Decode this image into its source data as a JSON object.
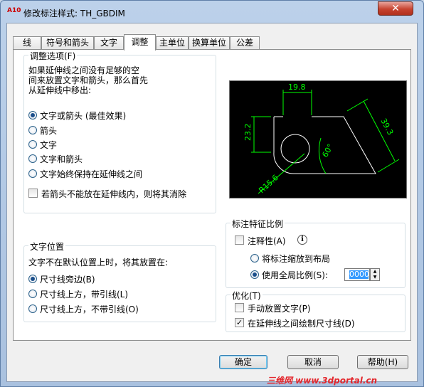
{
  "window": {
    "title": "修改标注样式: TH_GBDIM",
    "app_icon_text": "A10",
    "close_glyph": "✕"
  },
  "tabs": [
    {
      "label": "线",
      "active": false
    },
    {
      "label": "符号和箭头",
      "active": false
    },
    {
      "label": "文字",
      "active": false
    },
    {
      "label": "调整",
      "active": true
    },
    {
      "label": "主单位",
      "active": false
    },
    {
      "label": "换算单位",
      "active": false
    },
    {
      "label": "公差",
      "active": false
    }
  ],
  "fit_options": {
    "title": "调整选项(F)",
    "description": [
      "如果延伸线之间没有足够的空",
      "间来放置文字和箭头，那么首先",
      "从延伸线中移出:"
    ],
    "radios": [
      {
        "label": "文字或箭头 (最佳效果)",
        "checked": true
      },
      {
        "label": "箭头",
        "checked": false
      },
      {
        "label": "文字",
        "checked": false
      },
      {
        "label": "文字和箭头",
        "checked": false
      },
      {
        "label": "文字始终保持在延伸线之间",
        "checked": false
      }
    ],
    "suppress_checkbox": {
      "label": "若箭头不能放在延伸线内，则将其消除",
      "checked": false
    }
  },
  "text_placement": {
    "title": "文字位置",
    "description": "文字不在默认位置上时，将其放置在:",
    "radios": [
      {
        "label": "尺寸线旁边(B)",
        "checked": true
      },
      {
        "label": "尺寸线上方，带引线(L)",
        "checked": false
      },
      {
        "label": "尺寸线上方，不带引线(O)",
        "checked": false
      }
    ]
  },
  "scale": {
    "title": "标注特征比例",
    "annotative_label": "注释性(A)",
    "annotative_checked": false,
    "info_glyph": "i",
    "radios": [
      {
        "label": "将标注缩放到布局",
        "checked": false
      },
      {
        "label": "使用全局比例(S):",
        "checked": true
      }
    ],
    "global_scale_value": "0000"
  },
  "fine_tuning": {
    "title": "优化(T)",
    "checkboxes": [
      {
        "label": "手动放置文字(P)",
        "checked": false
      },
      {
        "label": "在延伸线之间绘制尺寸线(D)",
        "checked": true
      }
    ]
  },
  "preview": {
    "dimension_labels": [
      "19.8",
      "23.2",
      "39.3",
      "60°",
      "R15.6"
    ],
    "colors": {
      "background": "#000000",
      "dimension": "#00ff00",
      "geometry": "#ffffff",
      "arc": "#d9a441"
    }
  },
  "buttons": {
    "ok": "确定",
    "cancel": "取消",
    "help": "帮助(H)"
  },
  "watermark": "三维网 www.3dportal.cn",
  "check_glyph": "✓"
}
